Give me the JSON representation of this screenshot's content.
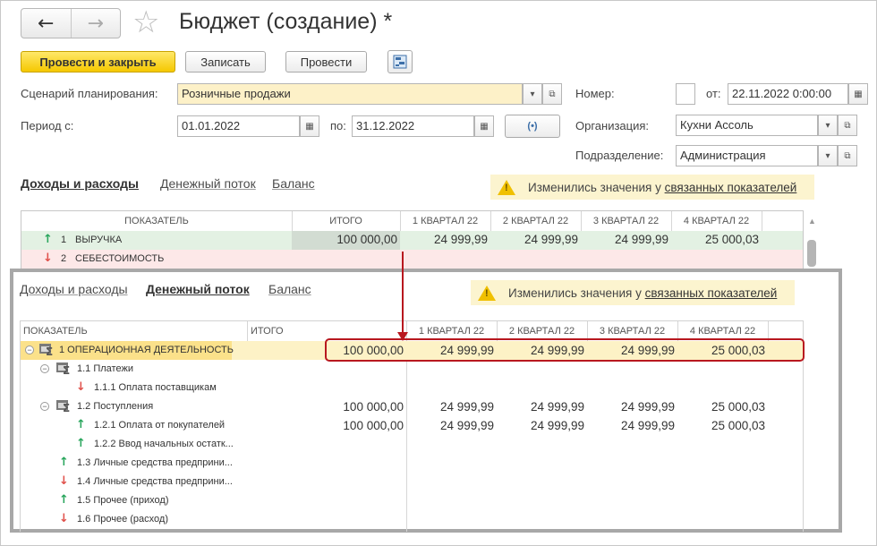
{
  "header": {
    "title": "Бюджет (создание) *",
    "back_icon": "←",
    "forward_icon": "→",
    "star_icon": "☆"
  },
  "toolbar": {
    "post_close": "Провести и закрыть",
    "save": "Записать",
    "post": "Провести"
  },
  "form": {
    "scenario_label": "Сценарий планирования:",
    "scenario_value": "Розничные продажи",
    "period_label": "Период с:",
    "period_from": "01.01.2022",
    "period_to_label": "по:",
    "period_to": "31.12.2022",
    "number_label": "Номер:",
    "from_label": "от:",
    "date_value": "22.11.2022  0:00:00",
    "org_label": "Организация:",
    "org_value": "Кухни Ассоль",
    "dept_label": "Подразделение:",
    "dept_value": "Администрация"
  },
  "tabs": [
    "Доходы и расходы",
    "Денежный поток",
    "Баланс"
  ],
  "warning": {
    "text": "Изменились значения у ",
    "link": "связанных показателей"
  },
  "table1": {
    "columns": [
      "ПОКАЗАТЕЛЬ",
      "ИТОГО",
      "1 КВАРТАЛ 22",
      "2 КВАРТАЛ 22",
      "3 КВАРТАЛ 22",
      "4 КВАРТАЛ 22"
    ],
    "rows": [
      {
        "num": "1",
        "name": "ВЫРУЧКА",
        "dir": "up",
        "total": "100 000,00",
        "q": [
          "24 999,99",
          "24 999,99",
          "24 999,99",
          "25 000,03"
        ]
      },
      {
        "num": "2",
        "name": "СЕБЕСТОИМОСТЬ",
        "dir": "down",
        "total": "",
        "q": [
          "",
          "",
          "",
          ""
        ]
      }
    ]
  },
  "table2": {
    "columns": [
      "ПОКАЗАТЕЛЬ",
      "ИТОГО",
      "1 КВАРТАЛ 22",
      "2 КВАРТАЛ 22",
      "3 КВАРТАЛ 22",
      "4 КВАРТАЛ 22"
    ],
    "rows": [
      {
        "label": "1   ОПЕРАЦИОННАЯ ДЕЯТЕЛЬНОСТЬ",
        "total": "100 000,00",
        "q1": "24 999,99",
        "q2": "24 999,99",
        "q3": "24 999,99",
        "q4": "25 000,03"
      },
      {
        "label": "1.1   Платежи",
        "total": "",
        "q1": "",
        "q2": "",
        "q3": "",
        "q4": ""
      },
      {
        "label": "1.1.1   Оплата поставщикам",
        "total": "",
        "q1": "",
        "q2": "",
        "q3": "",
        "q4": ""
      },
      {
        "label": "1.2   Поступления",
        "total": "100 000,00",
        "q1": "24 999,99",
        "q2": "24 999,99",
        "q3": "24 999,99",
        "q4": "25 000,03"
      },
      {
        "label": "1.2.1   Оплата от покупателей",
        "total": "100 000,00",
        "q1": "24 999,99",
        "q2": "24 999,99",
        "q3": "24 999,99",
        "q4": "25 000,03"
      },
      {
        "label": "1.2.2   Ввод начальных остатк...",
        "total": "",
        "q1": "",
        "q2": "",
        "q3": "",
        "q4": ""
      },
      {
        "label": "1.3   Личные средства предприни...",
        "total": "",
        "q1": "",
        "q2": "",
        "q3": "",
        "q4": ""
      },
      {
        "label": "1.4   Личные средства предприни...",
        "total": "",
        "q1": "",
        "q2": "",
        "q3": "",
        "q4": ""
      },
      {
        "label": "1.5   Прочее (приход)",
        "total": "",
        "q1": "",
        "q2": "",
        "q3": "",
        "q4": ""
      },
      {
        "label": "1.6   Прочее (расход)",
        "total": "",
        "q1": "",
        "q2": "",
        "q3": "",
        "q4": ""
      }
    ]
  }
}
